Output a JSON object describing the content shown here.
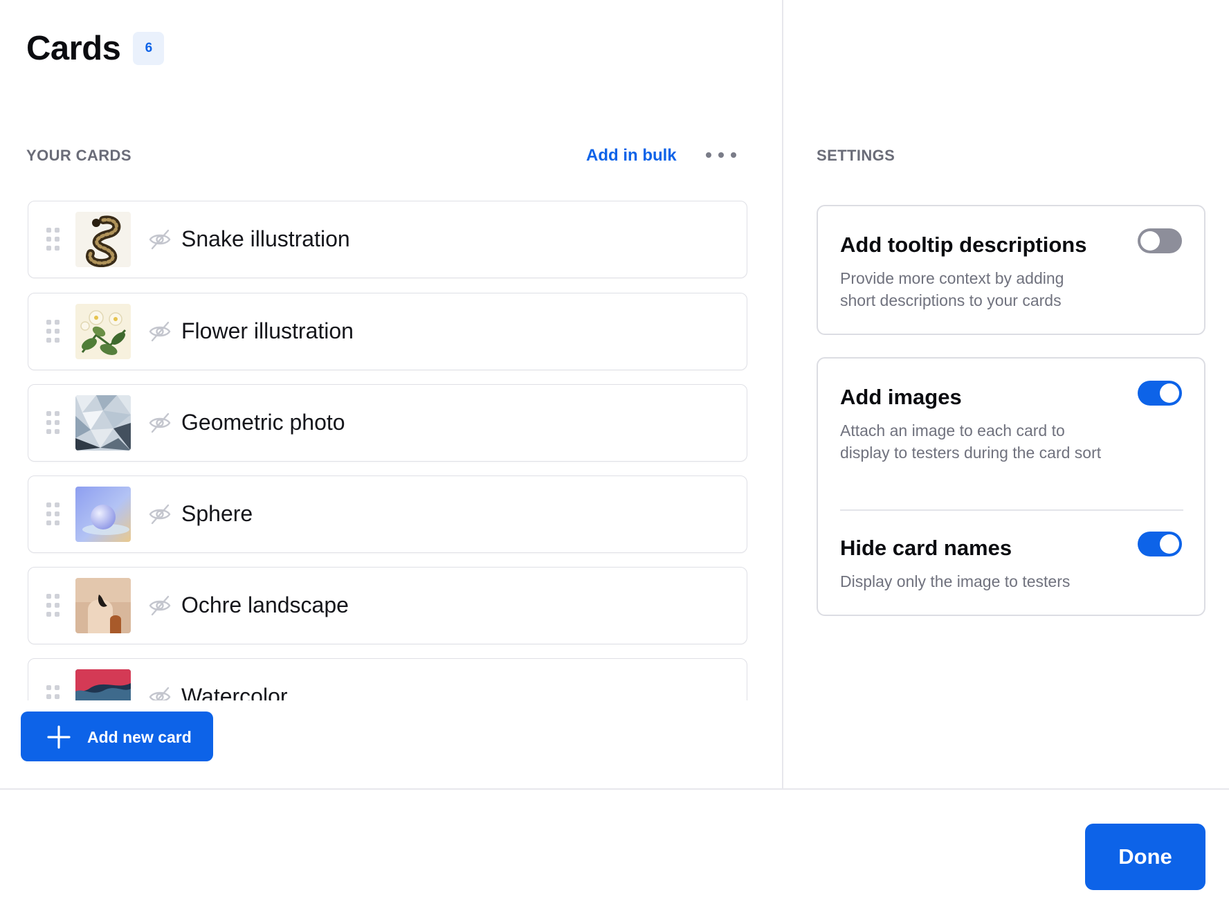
{
  "header": {
    "title": "Cards",
    "count": "6"
  },
  "cards_section": {
    "label": "YOUR CARDS",
    "add_bulk_label": "Add in bulk",
    "more_icon": "more-horizontal-icon",
    "cards": [
      {
        "name": "Snake illustration"
      },
      {
        "name": "Flower illustration"
      },
      {
        "name": "Geometric photo"
      },
      {
        "name": "Sphere"
      },
      {
        "name": "Ochre landscape"
      },
      {
        "name": "Watercolor"
      }
    ],
    "add_card_label": "Add new card"
  },
  "settings": {
    "label": "SETTINGS",
    "tooltip": {
      "title": "Add tooltip descriptions",
      "desc": "Provide more context by adding short descriptions to your cards",
      "enabled": false
    },
    "images": {
      "title": "Add images",
      "desc": "Attach an image to each card to display to testers during the card sort",
      "enabled": true
    },
    "hide_names": {
      "title": "Hide card names",
      "desc": "Display only the image to testers",
      "enabled": true
    }
  },
  "footer": {
    "done_label": "Done"
  },
  "colors": {
    "accent": "#0d63e8",
    "toggle_off": "#8d8e9a",
    "badge_bg": "#eaf1fc"
  }
}
